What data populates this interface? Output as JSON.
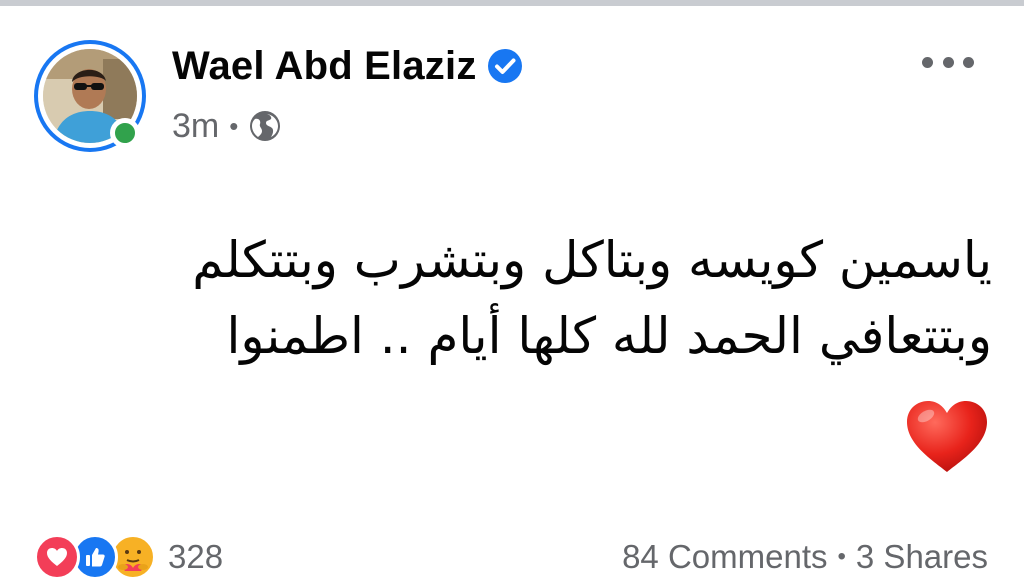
{
  "post": {
    "author_name": "Wael Abd Elaziz",
    "verified": true,
    "timestamp": "3m",
    "separator": "•",
    "audience_icon": "globe-icon",
    "more_icon": "more-horizontal-icon",
    "text_line_1": "ياسمين كويسه وبتاكل وبتشرب وبتتكلم",
    "text_line_2": "وبتتعافي الحمد لله كلها أيام .. اطمنوا",
    "trailing_emoji": "red-heart-icon"
  },
  "footer": {
    "reaction_icons": [
      "love-reaction-icon",
      "like-reaction-icon",
      "care-reaction-icon"
    ],
    "reaction_count": "328",
    "comments": "84 Comments",
    "separator": "•",
    "shares": "3 Shares"
  },
  "colors": {
    "facebook_blue": "#1877f2",
    "online_green": "#31a24c",
    "secondary_text": "#65676b",
    "primary_text": "#050505",
    "love_red": "#f33e58",
    "care_yellow": "#f7b125"
  }
}
